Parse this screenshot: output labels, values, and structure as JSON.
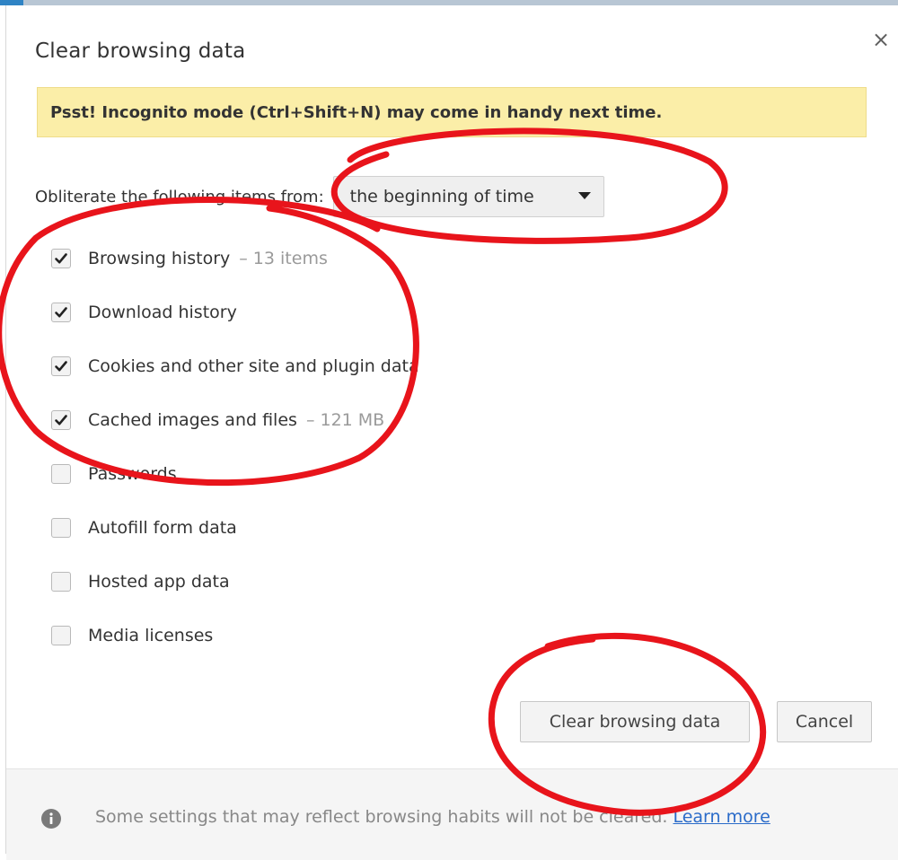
{
  "dialog": {
    "title": "Clear browsing data",
    "close_icon": "close-icon",
    "banner_text": "Psst! Incognito mode (Ctrl+Shift+N) may come in handy next time.",
    "range_label": "Obliterate the following items from:",
    "range_selected": "the beginning of time",
    "items": [
      {
        "label": "Browsing history",
        "extra": "–  13 items",
        "checked": true
      },
      {
        "label": "Download history",
        "extra": "",
        "checked": true
      },
      {
        "label": "Cookies and other site and plugin data",
        "extra": "",
        "checked": true
      },
      {
        "label": "Cached images and files",
        "extra": "–  121 MB",
        "checked": true
      },
      {
        "label": "Passwords",
        "extra": "",
        "checked": false
      },
      {
        "label": "Autofill form data",
        "extra": "",
        "checked": false
      },
      {
        "label": "Hosted app data",
        "extra": "",
        "checked": false
      },
      {
        "label": "Media licenses",
        "extra": "",
        "checked": false
      }
    ],
    "clear_button": "Clear browsing data",
    "cancel_button": "Cancel",
    "footer_text": "Some settings that may reflect browsing habits will not be cleared.",
    "learn_more": "Learn more"
  },
  "colors": {
    "banner_bg": "#fbeea8",
    "annotation_red": "#e8141b",
    "link_blue": "#2a6bc9"
  }
}
